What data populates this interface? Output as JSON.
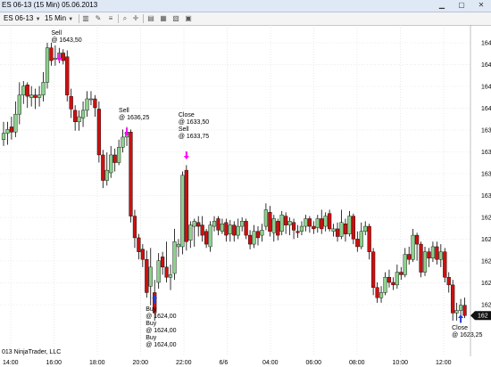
{
  "window": {
    "title": "ES 06-13 (15 Min)  05.06.2013",
    "min_icon": "minimize-icon",
    "max_icon": "maximize-icon",
    "close_icon": "close-icon"
  },
  "toolbar": {
    "instrument": "ES 06-13",
    "period": "15 Min",
    "icons": [
      "bar-chart-icon",
      "pencil-icon",
      "lines-icon",
      "zoom-icon",
      "crosshair-icon",
      "properties-icon",
      "strategies-icon",
      "indicators-icon",
      "data-box-icon"
    ]
  },
  "chart": {
    "copyright": "013 NinjaTrader, LLC",
    "x_ticks": [
      "14:00",
      "16:00",
      "18:00",
      "20:00",
      "22:00",
      "6/6",
      "04:00",
      "06:00",
      "08:00",
      "10:00",
      "12:00"
    ],
    "y_ticks": [
      "164",
      "164",
      "164",
      "164",
      "163",
      "163",
      "163",
      "163",
      "162",
      "162",
      "162",
      "162",
      "162"
    ],
    "last_price_label": "162",
    "colors": {
      "up": "#8ed08e",
      "down": "#cc1010",
      "grid": "#d9d9d9",
      "sell_arrow": "#ff00ff",
      "buy_arrow": "#1f3fe0"
    },
    "signals": [
      {
        "type": "sell",
        "lines": [
          "Sell",
          "@ 1643,50"
        ]
      },
      {
        "type": "sell",
        "lines": [
          "Sell",
          "@ 1636,25"
        ]
      },
      {
        "type": "sell",
        "lines": [
          "Close",
          "@ 1633,50",
          "Sell",
          "@ 1633,75"
        ]
      },
      {
        "type": "buy",
        "lines": [
          "Buy",
          "@ 1624,00",
          "Buy",
          "@ 1624,00",
          "Buy",
          "@ 1624,00"
        ]
      },
      {
        "type": "buy",
        "lines": [
          "Close",
          "@ 1623,25"
        ]
      }
    ]
  },
  "chart_data": {
    "type": "candlestick",
    "title": "ES 06-13 (15 Min)",
    "xlabel": "",
    "ylabel": "",
    "ylim": [
      1620,
      1646
    ],
    "candles": [
      [
        1637.0,
        1637.5,
        1638.4,
        1636.5
      ],
      [
        1637.5,
        1637.8,
        1638.4,
        1636.6
      ],
      [
        1638.0,
        1637.6,
        1638.8,
        1637.0
      ],
      [
        1637.6,
        1639.0,
        1640.0,
        1637.2
      ],
      [
        1639.0,
        1640.5,
        1641.5,
        1638.2
      ],
      [
        1640.5,
        1641.2,
        1641.6,
        1639.8
      ],
      [
        1641.3,
        1640.4,
        1641.5,
        1639.5
      ],
      [
        1640.3,
        1640.5,
        1641.2,
        1639.6
      ],
      [
        1640.5,
        1640.3,
        1641.0,
        1639.4
      ],
      [
        1640.3,
        1640.5,
        1641.2,
        1639.6
      ],
      [
        1640.5,
        1641.5,
        1642.3,
        1640.0
      ],
      [
        1641.5,
        1644.2,
        1644.6,
        1641.0
      ],
      [
        1644.2,
        1643.2,
        1644.6,
        1642.8
      ],
      [
        1643.3,
        1643.4,
        1644.4,
        1642.8
      ],
      [
        1643.4,
        1643.8,
        1644.2,
        1643.0
      ],
      [
        1643.8,
        1643.2,
        1644.1,
        1642.9
      ],
      [
        1643.5,
        1640.5,
        1644.0,
        1640.0
      ],
      [
        1640.4,
        1639.4,
        1641.0,
        1638.7
      ],
      [
        1639.3,
        1638.4,
        1639.7,
        1637.7
      ],
      [
        1638.4,
        1638.8,
        1639.3,
        1637.7
      ],
      [
        1638.7,
        1639.3,
        1640.0,
        1638.0
      ],
      [
        1639.3,
        1640.2,
        1640.8,
        1638.8
      ],
      [
        1640.2,
        1640.2,
        1640.8,
        1639.7
      ],
      [
        1640.2,
        1639.5,
        1640.5,
        1638.8
      ],
      [
        1639.4,
        1635.8,
        1640.0,
        1635.2
      ],
      [
        1635.8,
        1633.8,
        1636.2,
        1633.2
      ],
      [
        1633.8,
        1634.6,
        1636.0,
        1633.4
      ],
      [
        1634.4,
        1635.8,
        1636.5,
        1634.0
      ],
      [
        1635.8,
        1635.2,
        1636.3,
        1634.5
      ],
      [
        1635.2,
        1636.4,
        1637.0,
        1635.0
      ],
      [
        1636.4,
        1637.2,
        1637.8,
        1636.0
      ],
      [
        1637.2,
        1637.6,
        1638.0,
        1636.5
      ],
      [
        1637.6,
        1631.0,
        1637.8,
        1630.5
      ],
      [
        1631.0,
        1629.3,
        1631.5,
        1628.5
      ],
      [
        1629.3,
        1628.2,
        1629.6,
        1627.6
      ],
      [
        1628.4,
        1627.6,
        1628.8,
        1627.0
      ],
      [
        1627.6,
        1625.0,
        1628.3,
        1624.6
      ],
      [
        1625.5,
        1627.0,
        1628.5,
        1624.0
      ],
      [
        1625.0,
        1623.4,
        1626.0,
        1622.8
      ],
      [
        1625.8,
        1627.5,
        1628.1,
        1625.3
      ],
      [
        1627.8,
        1627.0,
        1628.2,
        1626.4
      ],
      [
        1627.0,
        1626.2,
        1629.0,
        1625.8
      ],
      [
        1626.2,
        1626.4,
        1627.2,
        1625.2
      ],
      [
        1626.5,
        1629.0,
        1630.0,
        1626.0
      ],
      [
        1628.6,
        1628.8,
        1629.2,
        1627.8
      ],
      [
        1628.6,
        1634.2,
        1634.5,
        1628.0
      ],
      [
        1634.6,
        1629.0,
        1635.0,
        1628.3
      ],
      [
        1629.1,
        1630.3,
        1630.6,
        1628.5
      ],
      [
        1630.2,
        1630.6,
        1630.8,
        1628.6
      ],
      [
        1630.5,
        1630.2,
        1631.0,
        1629.4
      ],
      [
        1630.3,
        1629.5,
        1631.0,
        1629.0
      ],
      [
        1629.8,
        1628.8,
        1630.0,
        1628.5
      ],
      [
        1628.6,
        1630.3,
        1630.6,
        1628.2
      ],
      [
        1630.2,
        1630.6,
        1631.0,
        1629.8
      ],
      [
        1630.8,
        1629.9,
        1631.0,
        1629.5
      ],
      [
        1629.8,
        1630.4,
        1630.8,
        1629.6
      ],
      [
        1630.5,
        1629.5,
        1630.8,
        1629.0
      ],
      [
        1629.6,
        1630.3,
        1630.7,
        1629.0
      ],
      [
        1630.3,
        1629.5,
        1630.6,
        1629.0
      ],
      [
        1629.5,
        1630.2,
        1630.8,
        1629.2
      ],
      [
        1630.2,
        1630.6,
        1630.9,
        1629.8
      ],
      [
        1630.6,
        1629.5,
        1630.8,
        1629.2
      ],
      [
        1629.5,
        1628.8,
        1629.9,
        1628.4
      ],
      [
        1628.8,
        1629.8,
        1630.3,
        1628.5
      ],
      [
        1629.8,
        1629.3,
        1630.2,
        1628.7
      ],
      [
        1629.5,
        1629.9,
        1630.4,
        1629.0
      ],
      [
        1630.2,
        1631.5,
        1632.0,
        1629.9
      ],
      [
        1631.3,
        1629.8,
        1631.8,
        1629.4
      ],
      [
        1629.7,
        1630.8,
        1631.1,
        1629.0
      ],
      [
        1630.6,
        1629.5,
        1630.8,
        1629.1
      ],
      [
        1629.8,
        1631.1,
        1631.4,
        1629.5
      ],
      [
        1631.0,
        1630.3,
        1631.3,
        1629.6
      ],
      [
        1630.3,
        1630.6,
        1630.9,
        1629.5
      ],
      [
        1630.5,
        1629.9,
        1630.8,
        1629.2
      ],
      [
        1629.8,
        1629.7,
        1630.3,
        1629.3
      ],
      [
        1629.8,
        1630.2,
        1630.6,
        1629.5
      ],
      [
        1630.2,
        1630.8,
        1631.1,
        1629.8
      ],
      [
        1630.8,
        1630.2,
        1631.0,
        1629.7
      ],
      [
        1630.2,
        1630.0,
        1630.6,
        1629.6
      ],
      [
        1630.1,
        1630.8,
        1631.1,
        1629.7
      ],
      [
        1630.8,
        1630.0,
        1631.5,
        1629.6
      ],
      [
        1630.2,
        1631.0,
        1631.3,
        1629.8
      ],
      [
        1631.2,
        1630.0,
        1631.5,
        1629.8
      ],
      [
        1629.8,
        1630.0,
        1630.4,
        1629.4
      ],
      [
        1630.0,
        1629.4,
        1630.5,
        1629.0
      ],
      [
        1629.4,
        1630.5,
        1631.5,
        1629.2
      ],
      [
        1630.4,
        1629.6,
        1630.8,
        1629.0
      ],
      [
        1629.6,
        1631.0,
        1631.4,
        1629.4
      ],
      [
        1631.0,
        1629.2,
        1631.2,
        1628.8
      ],
      [
        1629.2,
        1628.6,
        1629.8,
        1628.2
      ],
      [
        1628.6,
        1629.8,
        1630.5,
        1628.4
      ],
      [
        1629.8,
        1630.2,
        1630.6,
        1629.5
      ],
      [
        1630.2,
        1628.2,
        1630.4,
        1627.6
      ],
      [
        1628.2,
        1625.4,
        1628.5,
        1624.8
      ],
      [
        1625.4,
        1624.6,
        1625.8,
        1624.2
      ],
      [
        1624.6,
        1625.0,
        1625.5,
        1624.2
      ],
      [
        1625.0,
        1626.2,
        1626.6,
        1624.8
      ],
      [
        1626.2,
        1625.8,
        1626.8,
        1625.4
      ],
      [
        1625.8,
        1625.6,
        1626.2,
        1625.2
      ],
      [
        1625.6,
        1626.6,
        1627.2,
        1625.3
      ],
      [
        1626.6,
        1626.4,
        1627.0,
        1626.0
      ],
      [
        1626.4,
        1628.0,
        1628.5,
        1626.2
      ],
      [
        1628.0,
        1627.6,
        1628.6,
        1627.2
      ],
      [
        1627.6,
        1629.5,
        1630.0,
        1627.4
      ],
      [
        1629.5,
        1628.8,
        1629.7,
        1627.5
      ],
      [
        1628.8,
        1626.6,
        1629.0,
        1626.2
      ],
      [
        1626.6,
        1628.2,
        1628.6,
        1626.3
      ],
      [
        1628.2,
        1627.7,
        1628.5,
        1627.0
      ],
      [
        1627.7,
        1628.6,
        1629.0,
        1627.4
      ],
      [
        1628.6,
        1627.6,
        1629.0,
        1627.2
      ],
      [
        1627.6,
        1628.2,
        1628.8,
        1627.0
      ],
      [
        1628.2,
        1626.2,
        1628.5,
        1625.8
      ],
      [
        1626.2,
        1625.6,
        1626.6,
        1625.0
      ],
      [
        1625.6,
        1623.4,
        1626.0,
        1622.8
      ],
      [
        1623.4,
        1623.6,
        1624.2,
        1622.8
      ],
      [
        1623.6,
        1624.0,
        1624.5,
        1622.6
      ],
      [
        1624.0,
        1623.2,
        1624.6,
        1623.0
      ]
    ],
    "columns": [
      "open",
      "close",
      "high",
      "low"
    ]
  }
}
